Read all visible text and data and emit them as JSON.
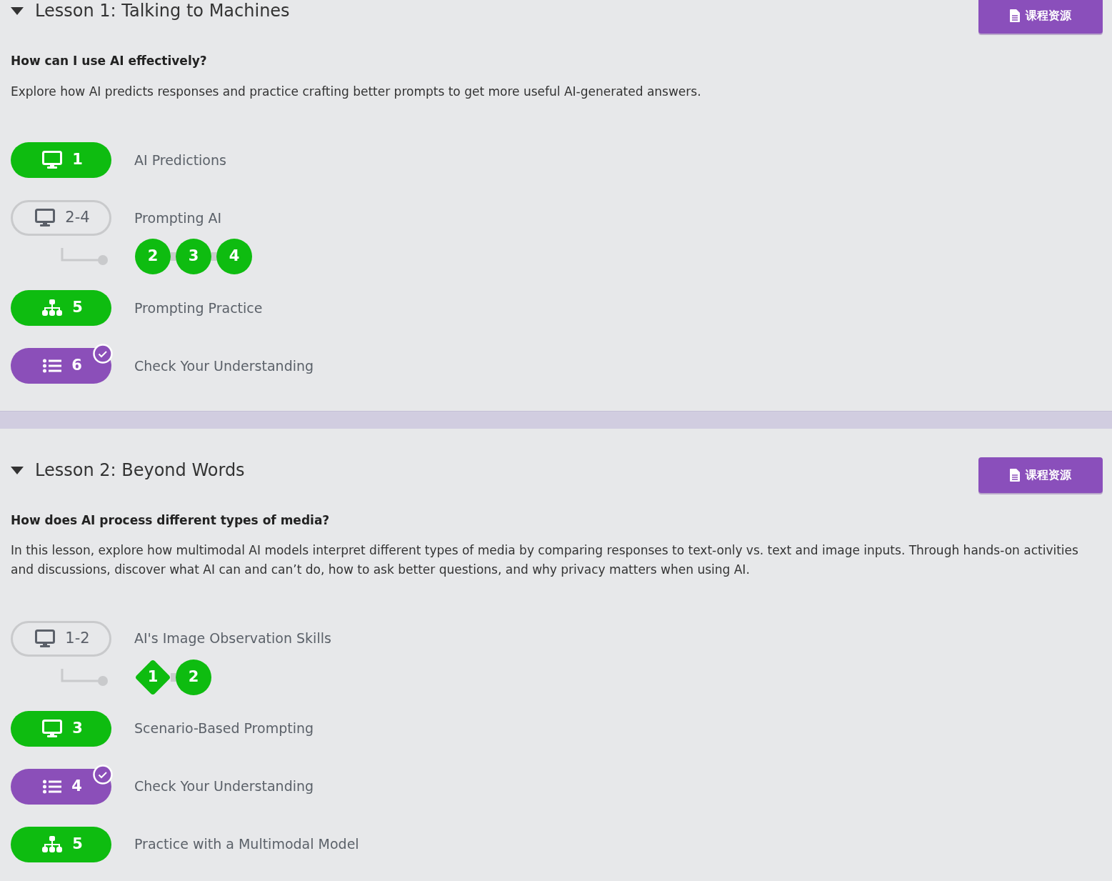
{
  "lessons": [
    {
      "title": "Lesson 1: Talking to Machines",
      "expanded": true,
      "resources_button": "课程资源",
      "question": "How can I use AI effectively?",
      "description": "Explore how AI predicts responses and practice crafting better prompts to get more useful AI-generated answers.",
      "levels": [
        {
          "kind": "slides",
          "label": "1",
          "name": "AI Predictions",
          "completed": true
        },
        {
          "kind": "group",
          "label": "2-4",
          "name": "Prompting AI",
          "completed": false,
          "sublevels": [
            {
              "kind": "circle",
              "label": "2",
              "completed": true
            },
            {
              "kind": "circle",
              "label": "3",
              "completed": true
            },
            {
              "kind": "circle",
              "label": "4",
              "completed": true
            }
          ]
        },
        {
          "kind": "practice",
          "label": "5",
          "name": "Prompting Practice",
          "completed": true
        },
        {
          "kind": "assessment",
          "label": "6",
          "name": "Check Your Understanding",
          "completed": true,
          "checked": true
        }
      ]
    },
    {
      "title": "Lesson 2: Beyond Words",
      "expanded": true,
      "resources_button": "课程资源",
      "question": "How does AI process different types of media?",
      "description": "In this lesson, explore how multimodal AI models interpret different types of media by comparing responses to text-only vs. text and image inputs. Through hands-on activities and discussions, discover what AI can and can’t do, how to ask better questions, and why privacy matters when using AI.",
      "levels": [
        {
          "kind": "group",
          "label": "1-2",
          "name": "AI's Image Observation Skills",
          "completed": false,
          "sublevels": [
            {
              "kind": "diamond",
              "label": "1",
              "completed": true
            },
            {
              "kind": "circle",
              "label": "2",
              "completed": true
            }
          ]
        },
        {
          "kind": "slides",
          "label": "3",
          "name": "Scenario-Based Prompting",
          "completed": true
        },
        {
          "kind": "assessment",
          "label": "4",
          "name": "Check Your Understanding",
          "completed": true,
          "checked": true
        },
        {
          "kind": "practice",
          "label": "5",
          "name": "Practice with a Multimodal Model",
          "completed": true
        }
      ]
    }
  ]
}
